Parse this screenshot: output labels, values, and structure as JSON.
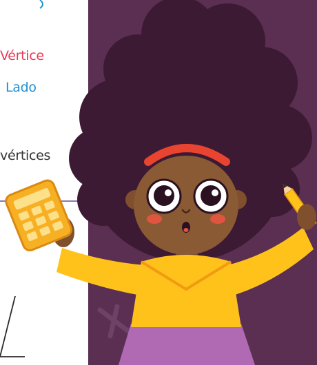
{
  "labels": {
    "vertice": "Vértice",
    "lado": "Lado",
    "vertices": "vértices"
  },
  "colors": {
    "vertice_label": "#e63a55",
    "lado_label": "#1e8fd0",
    "vertices_label": "#333333",
    "background": "#5a2f52",
    "hair": "#3c1a33",
    "skin": "#8a5a34",
    "shirt": "#ffc21a",
    "skirt": "#b06ab3",
    "headband": "#e8442f",
    "calculator": "#f7b023"
  },
  "icons": {
    "left_diagram": "triangle-diagram",
    "calculator": "calculator-icon",
    "pencil": "pencil-icon",
    "background_mark": "cross-mark-icon"
  }
}
